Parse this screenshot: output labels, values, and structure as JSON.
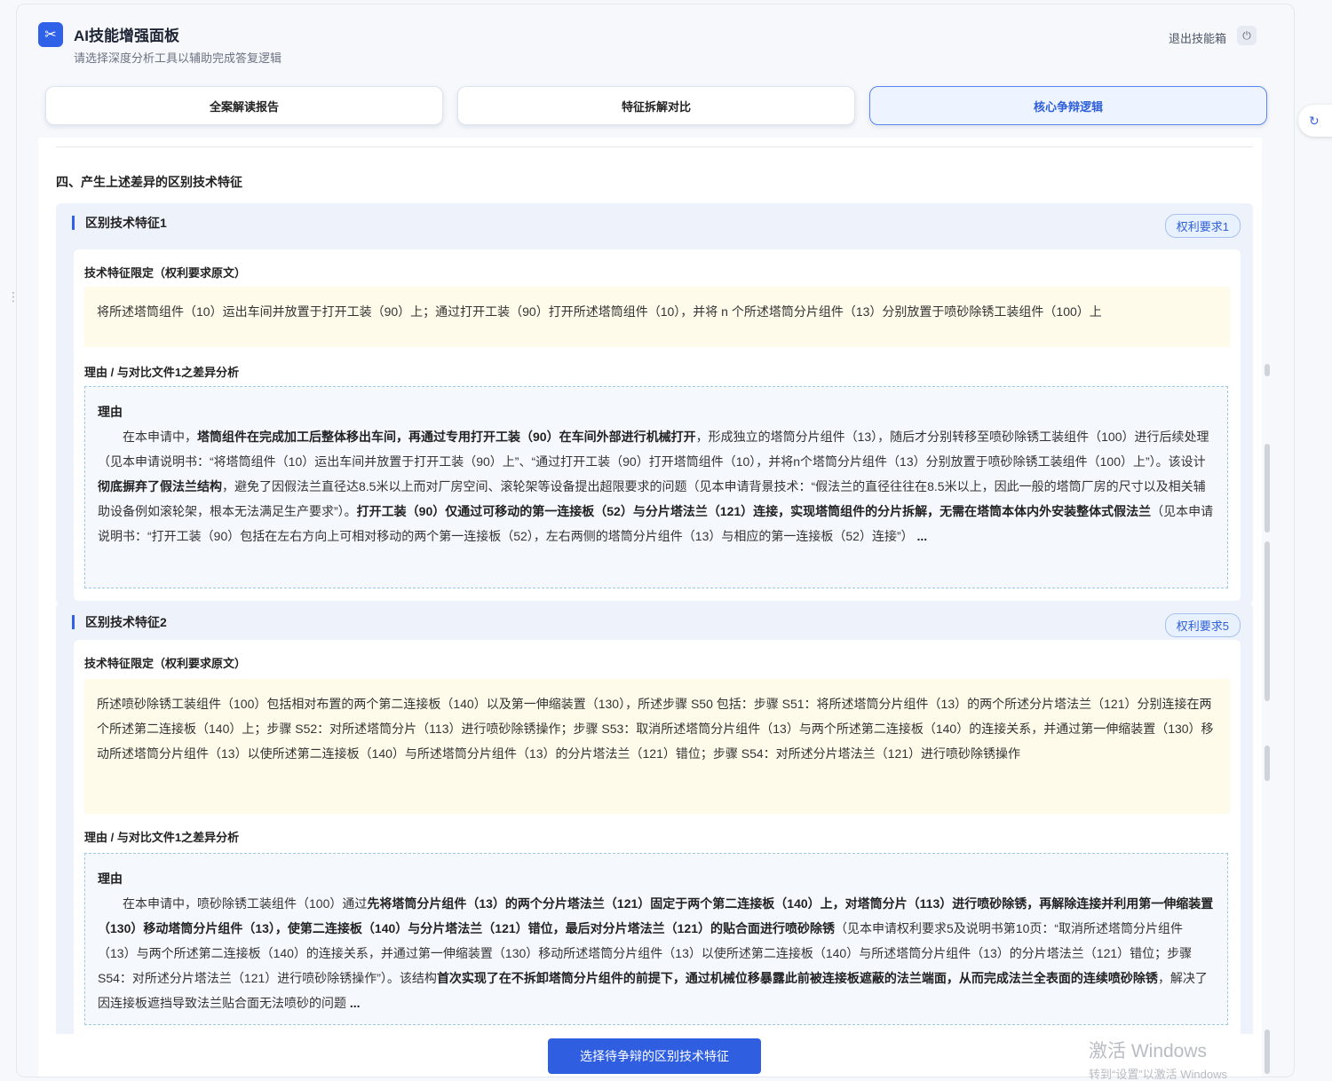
{
  "header": {
    "title": "AI技能增强面板",
    "subtitle": "请选择深度分析工具以辅助完成答复逻辑",
    "exit_label": "退出技能箱",
    "logo_icon": "tools-icon",
    "power_icon": "power-icon"
  },
  "tabs": [
    {
      "label": "全案解读报告",
      "active": false
    },
    {
      "label": "特征拆解对比",
      "active": false
    },
    {
      "label": "核心争辩逻辑",
      "active": true
    }
  ],
  "section": {
    "title": "四、产生上述差异的区别技术特征"
  },
  "features": [
    {
      "title": "区别技术特征1",
      "badge": "权利要求1",
      "limit_label": "技术特征限定（权利要求原文）",
      "limit_text": "将所述塔筒组件（10）运出车间并放置于打开工装（90）上；通过打开工装（90）打开所述塔筒组件（10），并将 n 个所述塔筒分片组件（13）分别放置于喷砂除锈工装组件（100）上",
      "reason_section_label": "理由 / 与对比文件1之差异分析",
      "reason_label": "理由",
      "reason_parts": [
        "在本申请中，",
        "塔筒组件在完成加工后整体移出车间，再通过专用打开工装（90）在车间外部进行机械打开",
        "，形成独立的塔筒分片组件（13），随后才分别转移至喷砂除锈工装组件（100）进行后续处理（见本申请说明书：“将塔筒组件（10）运出车间并放置于打开工装（90）上”、“通过打开工装（90）打开塔筒组件（10），并将n个塔筒分片组件（13）分别放置于喷砂除锈工装组件（100）上”）。该设计",
        "彻底摒弃了假法兰结构",
        "，避免了因假法兰直径达8.5米以上而对厂房空间、滚轮架等设备提出超限要求的问题（见本申请背景技术：“假法兰的直径往往在8.5米以上，因此一般的塔筒厂房的尺寸以及相关辅助设备例如滚轮架，根本无法满足生产要求”）。",
        "打开工装（90）仅通过可移动的第一连接板（52）与分片塔法兰（121）连接，实现塔筒组件的分片拆解，无需在塔筒本体内外安装整体式假法兰",
        "（见本申请说明书：“打开工装（90）包括在左右方向上可相对移动的两个第一连接板（52），左右两侧的塔筒分片组件（13）与相应的第一连接板（52）连接”）",
        "..."
      ]
    },
    {
      "title": "区别技术特征2",
      "badge": "权利要求5",
      "limit_label": "技术特征限定（权利要求原文）",
      "limit_text": "所述喷砂除锈工装组件（100）包括相对布置的两个第二连接板（140）以及第一伸缩装置（130），所述步骤 S50 包括：步骤 S51：将所述塔筒分片组件（13）的两个所述分片塔法兰（121）分别连接在两个所述第二连接板（140）上；步骤 S52：对所述塔筒分片（113）进行喷砂除锈操作；步骤 S53：取消所述塔筒分片组件（13）与两个所述第二连接板（140）的连接关系，并通过第一伸缩装置（130）移动所述塔筒分片组件（13）以使所述第二连接板（140）与所述塔筒分片组件（13）的分片塔法兰（121）错位；步骤 S54：对所述分片塔法兰（121）进行喷砂除锈操作",
      "reason_section_label": "理由 / 与对比文件1之差异分析",
      "reason_label": "理由",
      "reason_parts": [
        "在本申请中，喷砂除锈工装组件（100）通过",
        "先将塔筒分片组件（13）的两个分片塔法兰（121）固定于两个第二连接板（140）上，对塔筒分片（113）进行喷砂除锈，再解除连接并利用第一伸缩装置（130）移动塔筒分片组件（13），使第二连接板（140）与分片塔法兰（121）错位，最后对分片塔法兰（121）的贴合面进行喷砂除锈",
        "（见本申请权利要求5及说明书第10页：“取消所述塔筒分片组件（13）与两个所述第二连接板（140）的连接关系，并通过第一伸缩装置（130）移动所述塔筒分片组件（13）以使所述第二连接板（140）与所述塔筒分片组件（13）的分片塔法兰（121）错位；步骤 S54：对所述分片塔法兰（121）进行喷砂除锈操作”）。该结构",
        "首次实现了在不拆卸塔筒分片组件的前提下，通过机械位移暴露此前被连接板遮蔽的法兰端面，从而完成法兰全表面的连续喷砂除锈",
        "，解决了因连接板遮挡导致法兰贴合面无法喷砂的问题",
        "..."
      ]
    }
  ],
  "footer": {
    "cta_label": "选择待争辩的区别技术特征"
  },
  "watermark": {
    "line1": "激活 Windows",
    "line2": "转到“设置”以激活 Windows"
  },
  "colors": {
    "accent": "#2f62e8",
    "quote_bg": "#fffbea",
    "reason_border": "#9dc8e6"
  }
}
